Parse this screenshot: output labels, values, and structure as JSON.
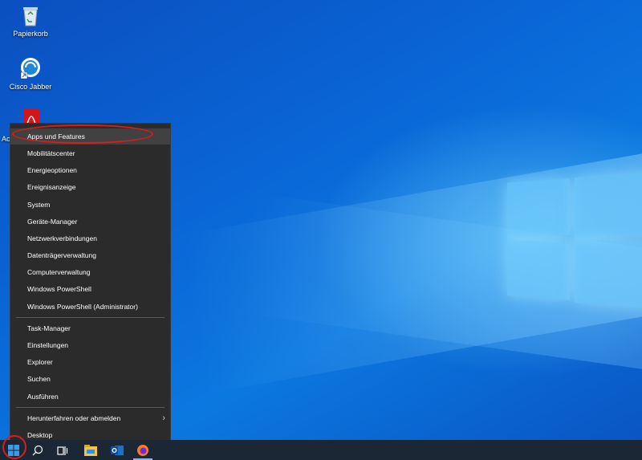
{
  "desktop": {
    "icons": [
      {
        "label": "Papierkorb",
        "icon": "recycle-bin-icon"
      },
      {
        "label": "Cisco Jabber",
        "icon": "cisco-jabber-icon"
      },
      {
        "label": "Ac",
        "icon": "acrobat-reader-icon"
      }
    ]
  },
  "context_menu": {
    "group1": [
      "Apps und Features",
      "Mobilitätscenter",
      "Energieoptionen",
      "Ereignisanzeige",
      "System",
      "Geräte-Manager",
      "Netzwerkverbindungen",
      "Datenträgerverwaltung",
      "Computerverwaltung",
      "Windows PowerShell",
      "Windows PowerShell (Administrator)"
    ],
    "group2": [
      "Task-Manager",
      "Einstellungen",
      "Explorer",
      "Suchen",
      "Ausführen"
    ],
    "group3": [
      "Herunterfahren oder abmelden",
      "Desktop"
    ],
    "submenu_arrow": "›"
  },
  "taskbar": {
    "items": [
      "start-icon",
      "search-icon",
      "task-view-icon",
      "file-explorer-icon",
      "outlook-icon",
      "firefox-icon"
    ]
  },
  "colors": {
    "menu_bg": "#2b2b2b",
    "highlight": "#414141",
    "annotation": "#d81d1d",
    "taskbar": "#1b2735"
  }
}
